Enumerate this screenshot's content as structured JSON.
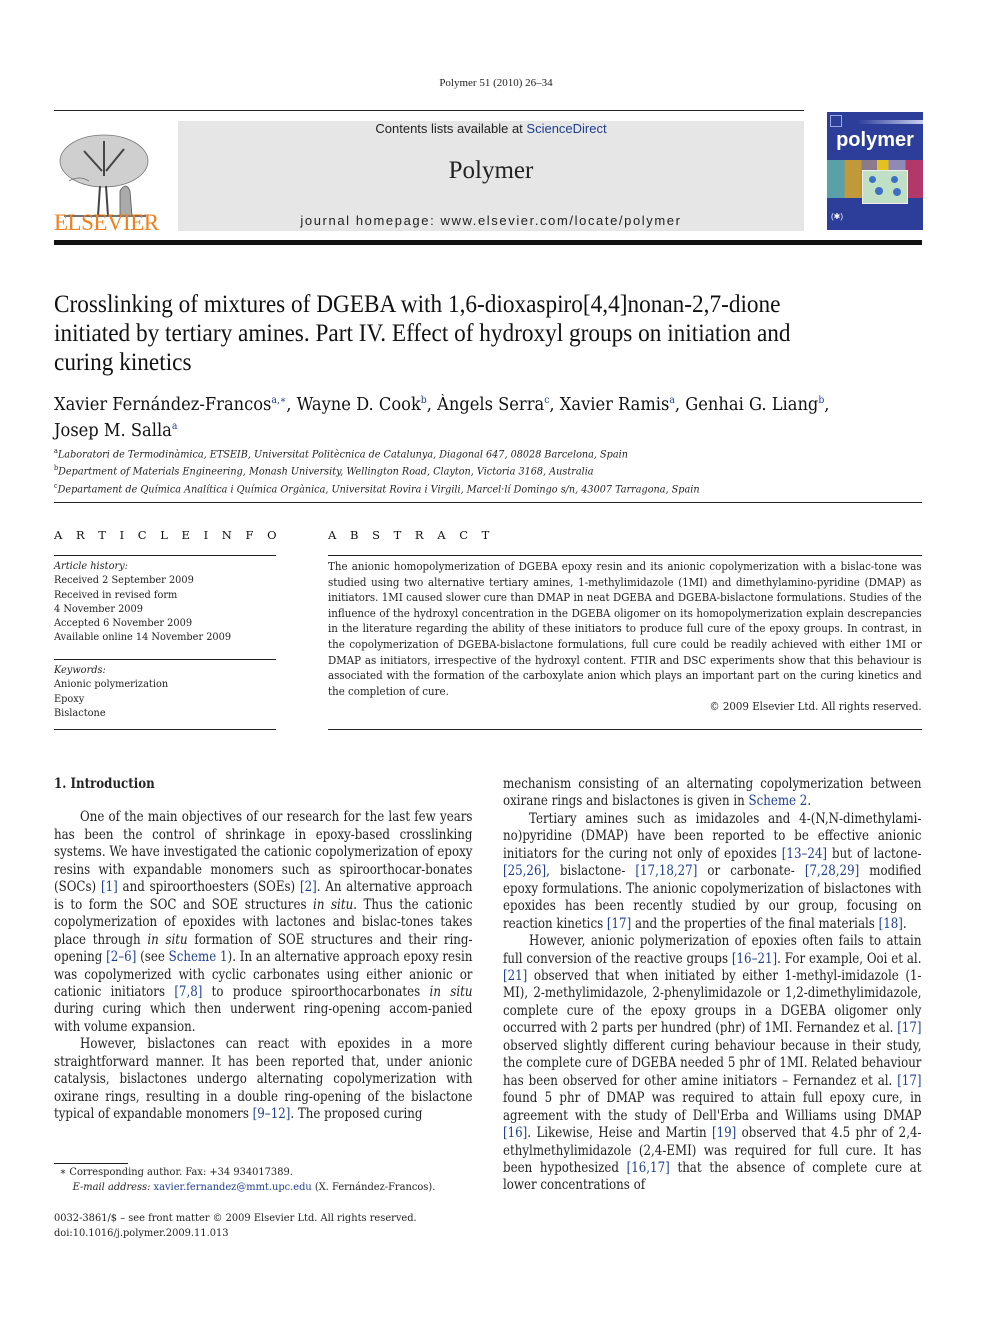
{
  "running_head": "Polymer 51 (2010) 26–34",
  "masthead": {
    "contents_prefix": "Contents lists available at ",
    "contents_link": "ScienceDirect",
    "journal_name": "Polymer",
    "homepage": "journal homepage: www.elsevier.com/locate/polymer",
    "publisher_logo_text": "ELSEVIER",
    "cover_title": "polymer",
    "brand_color": "#f07f1c",
    "cover_color": "#2c3d9a",
    "link_color": "#1f3f8f"
  },
  "article": {
    "title": "Crosslinking of mixtures of DGEBA with 1,6-dioxaspiro[4,4]nonan-2,7-dione initiated by tertiary amines. Part IV. Effect of hydroxyl groups on initiation and curing kinetics",
    "authors": [
      {
        "name": "Xavier Fernández-Francos",
        "sup": "a,∗",
        "sep": ", "
      },
      {
        "name": "Wayne D. Cook",
        "sup": "b",
        "sep": ", "
      },
      {
        "name": "Àngels Serra",
        "sup": "c",
        "sep": ", "
      },
      {
        "name": "Xavier Ramis",
        "sup": "a",
        "sep": ", "
      },
      {
        "name": "Genhai G. Liang",
        "sup": "b",
        "sep": ", "
      },
      {
        "name": "Josep M. Salla",
        "sup": "a",
        "sep": ""
      }
    ],
    "affiliations": [
      {
        "sup": "a",
        "text": "Laboratori de Termodinàmica, ETSEIB, Universitat Politècnica de Catalunya, Diagonal 647, 08028 Barcelona, Spain"
      },
      {
        "sup": "b",
        "text": "Department of Materials Engineering, Monash University, Wellington Road, Clayton, Victoria 3168, Australia"
      },
      {
        "sup": "c",
        "text": "Departament de Química Analítica i Química Orgànica, Universitat Rovira i Virgili, Marcel·lí Domingo s/n, 43007 Tarragona, Spain"
      }
    ]
  },
  "article_info": {
    "label": "A R T I C L E   I N F O",
    "history_label": "Article history:",
    "history": [
      "Received 2 September 2009",
      "Received in revised form",
      "4 November 2009",
      "Accepted 6 November 2009",
      "Available online 14 November 2009"
    ],
    "keywords_label": "Keywords:",
    "keywords": [
      "Anionic polymerization",
      "Epoxy",
      "Bislactone"
    ]
  },
  "abstract": {
    "label": "A B S T R A C T",
    "text": "The anionic homopolymerization of DGEBA epoxy resin and its anionic copolymerization with a bislac-tone was studied using two alternative tertiary amines, 1-methylimidazole (1MI) and dimethylamino-pyridine (DMAP) as initiators. 1MI caused slower cure than DMAP in neat DGEBA and DGEBA-bislactone formulations. Studies of the influence of the hydroxyl concentration in the DGEBA oligomer on its homopolymerization explain descrepancies in the literature regarding the ability of these initiators to produce full cure of the epoxy groups. In contrast, in the copolymerization of DGEBA-bislactone formulations, full cure could be readily achieved with either 1MI or DMAP as initiators, irrespective of the hydroxyl content. FTIR and DSC experiments show that this behaviour is associated with the formation of the carboxylate anion which plays an important part on the curing kinetics and the completion of cure.",
    "copyright": "© 2009 Elsevier Ltd. All rights reserved."
  },
  "body": {
    "heading": "1.  Introduction",
    "left_paragraphs": [
      [
        {
          "t": "One of the main objectives of our research for the last few years has been the control of shrinkage in epoxy-based crosslinking systems. We have investigated the cationic copolymerization of epoxy resins with expandable monomers such as spiroorthocar-bonates (SOCs) "
        },
        {
          "r": "[1]"
        },
        {
          "t": " and spiroorthoesters (SOEs) "
        },
        {
          "r": "[2]"
        },
        {
          "t": ". An alternative approach is to form the SOC and SOE structures "
        },
        {
          "i": "in situ"
        },
        {
          "t": ". Thus the cationic copolymerization of epoxides with lactones and bislac-tones takes place through "
        },
        {
          "i": "in situ"
        },
        {
          "t": " formation of SOE structures and their ring-opening "
        },
        {
          "r": "[2–6]"
        },
        {
          "t": " (see "
        },
        {
          "r": "Scheme 1"
        },
        {
          "t": "). In an alternative approach epoxy resin was copolymerized with cyclic carbonates using either anionic or cationic initiators "
        },
        {
          "r": "[7,8]"
        },
        {
          "t": " to produce spiroorthocarbonates "
        },
        {
          "i": "in situ"
        },
        {
          "t": " during curing which then underwent ring-opening accom-panied with volume expansion."
        }
      ],
      [
        {
          "t": "However, bislactones can react with epoxides in a more straightforward manner. It has been reported that, under anionic catalysis, bislactones undergo alternating copolymerization with oxirane rings, resulting in a double ring-opening of the bislactone typical of expandable monomers "
        },
        {
          "r": "[9–12]"
        },
        {
          "t": ". The proposed curing"
        }
      ]
    ],
    "right_paragraphs": [
      [
        {
          "t": "mechanism consisting of an alternating copolymerization between oxirane rings and bislactones is given in "
        },
        {
          "r": "Scheme 2"
        },
        {
          "t": "."
        }
      ],
      [
        {
          "t": "Tertiary amines such as imidazoles and 4-(N,N-dimethylami-no)pyridine (DMAP) have been reported to be effective anionic initiators for the curing not only of epoxides "
        },
        {
          "r": "[13–24]"
        },
        {
          "t": " but of lactone- "
        },
        {
          "r": "[25,26]"
        },
        {
          "t": ", bislactone- "
        },
        {
          "r": "[17,18,27]"
        },
        {
          "t": " or carbonate- "
        },
        {
          "r": "[7,28,29]"
        },
        {
          "t": " modified epoxy formulations. The anionic copolymerization of bislactones with epoxides has been recently studied by our group, focusing on reaction kinetics "
        },
        {
          "r": "[17]"
        },
        {
          "t": " and the properties of the final materials "
        },
        {
          "r": "[18]"
        },
        {
          "t": "."
        }
      ],
      [
        {
          "t": "However, anionic polymerization of epoxies often fails to attain full conversion of the reactive groups "
        },
        {
          "r": "[16–21]"
        },
        {
          "t": ". For example, Ooi et al. "
        },
        {
          "r": "[21]"
        },
        {
          "t": " observed that when initiated by either 1-methyl-imidazole (1-MI), 2-methylimidazole, 2-phenylimidazole or 1,2-dimethylimidazole, complete cure of the epoxy groups in a DGEBA oligomer only occurred with 2 parts per hundred (phr) of 1MI. Fernandez et al. "
        },
        {
          "r": "[17]"
        },
        {
          "t": " observed slightly different curing behaviour because in their study, the complete cure of DGEBA needed 5 phr of 1MI. Related behaviour has been observed for other amine initiators – Fernandez et al. "
        },
        {
          "r": "[17]"
        },
        {
          "t": " found 5 phr of DMAP was required to attain full epoxy cure, in agreement with the study of Dell'Erba and Williams using DMAP "
        },
        {
          "r": "[16]"
        },
        {
          "t": ". Likewise, Heise and Martin "
        },
        {
          "r": "[19]"
        },
        {
          "t": " observed that 4.5 phr of 2,4-ethylmethylimidazole (2,4-EMI) was required for full cure. It has been hypothesized "
        },
        {
          "r": "[16,17]"
        },
        {
          "t": " that the absence of complete cure at lower concentrations of"
        }
      ]
    ]
  },
  "footnotes": {
    "corresponding": "∗  Corresponding author. Fax: +34 934017389.",
    "email_label": "E-mail address: ",
    "email": "xavier.fernandez@mmt.upc.edu",
    "email_suffix": " (X. Fernández-Francos).",
    "issn": "0032-3861/$ – see front matter © 2009 Elsevier Ltd. All rights reserved.",
    "doi": "doi:10.1016/j.polymer.2009.11.013"
  }
}
